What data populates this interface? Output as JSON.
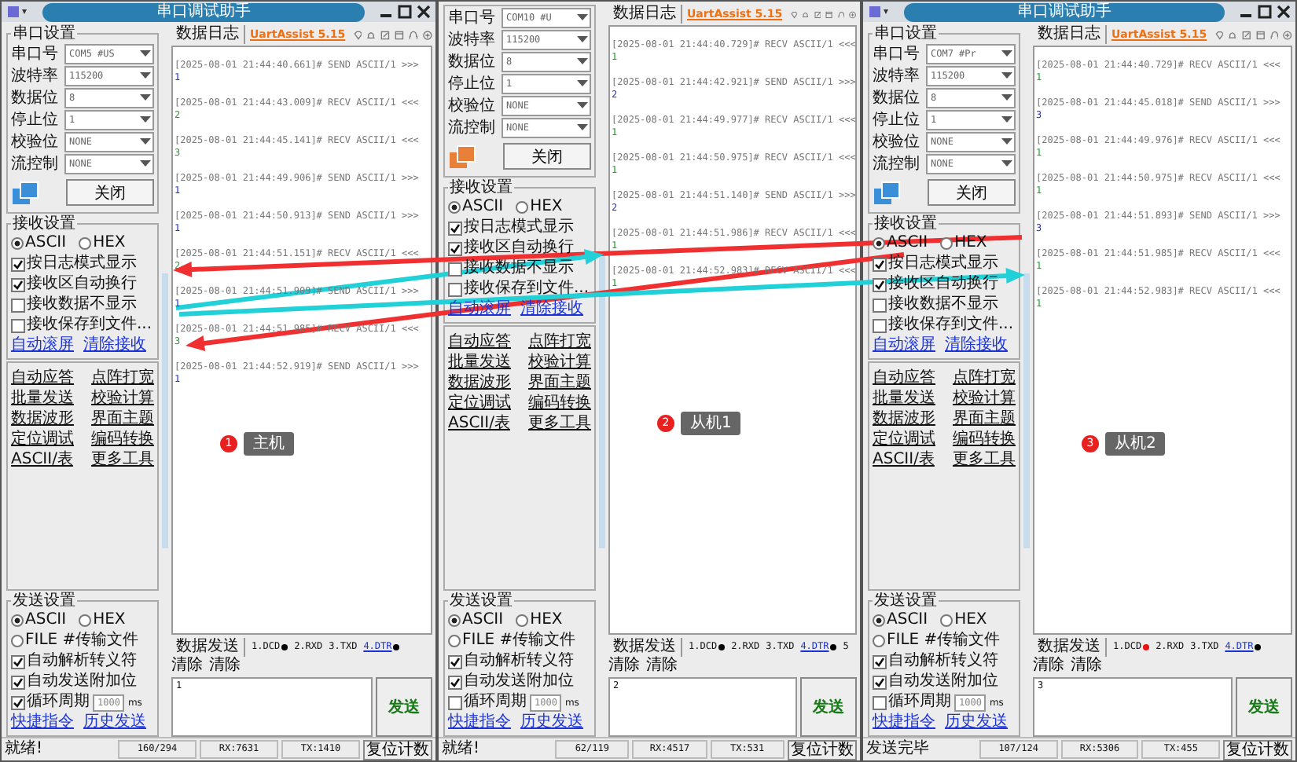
{
  "windows": [
    {
      "title": "串口调试助手",
      "port_settings": {
        "title": "串口设置",
        "fields": [
          {
            "label": "串口号",
            "value": "COM5 #US"
          },
          {
            "label": "波特率",
            "value": "115200"
          },
          {
            "label": "数据位",
            "value": "8"
          },
          {
            "label": "停止位",
            "value": "1"
          },
          {
            "label": "校验位",
            "value": "NONE"
          },
          {
            "label": "流控制",
            "value": "NONE"
          }
        ],
        "color": "#3a8fd8",
        "close_button": "关闭"
      },
      "receive_settings": {
        "title": "接收设置",
        "modes": [
          {
            "label": "ASCII",
            "selected": true
          },
          {
            "label": "HEX",
            "selected": false
          }
        ],
        "options": [
          {
            "label": "按日志模式显示",
            "checked": true
          },
          {
            "label": "接收区自动换行",
            "checked": true
          },
          {
            "label": "接收数据不显示",
            "checked": false
          },
          {
            "label": "接收保存到文件...",
            "checked": false
          }
        ],
        "links": [
          "自动滚屏",
          "清除接收"
        ]
      },
      "tools": [
        "自动应答",
        "点阵打宽",
        "批量发送",
        "校验计算",
        "数据波形",
        "界面主题",
        "定位调试",
        "编码转换",
        "ASCII/表",
        "更多工具"
      ],
      "send_settings": {
        "title": "发送设置",
        "modes": [
          {
            "label": "ASCII",
            "selected": true
          },
          {
            "label": "HEX",
            "selected": false
          }
        ],
        "file_mode": {
          "label": "FILE #传输文件",
          "selected": false
        },
        "options": [
          {
            "label": "自动解析转义符",
            "checked": true
          },
          {
            "label": "自动发送附加位",
            "checked": true
          }
        ],
        "cycle": {
          "label": "循环周期",
          "checked": true,
          "value": "1000",
          "unit": "ms"
        },
        "links": [
          "快捷指令",
          "历史发送"
        ]
      },
      "log_tab": "数据日志",
      "brand": "UartAssist 5.15",
      "log": [
        {
          "header": "[2025-08-01 21:44:40.661]# SEND ASCII/1 >>>",
          "kind": "send",
          "data": "1"
        },
        {
          "header": "[2025-08-01 21:44:43.009]# RECV ASCII/1 <<<",
          "kind": "recv",
          "data": "2"
        },
        {
          "header": "[2025-08-01 21:44:45.141]# RECV ASCII/1 <<<",
          "kind": "recv",
          "data": "3"
        },
        {
          "header": "[2025-08-01 21:44:49.906]# SEND ASCII/1 >>>",
          "kind": "send",
          "data": "1"
        },
        {
          "header": "[2025-08-01 21:44:50.913]# SEND ASCII/1 >>>",
          "kind": "send",
          "data": "1"
        },
        {
          "header": "[2025-08-01 21:44:51.151]# RECV ASCII/1 <<<",
          "kind": "recv",
          "data": "2"
        },
        {
          "header": "[2025-08-01 21:44:51.909]# SEND ASCII/1 >>>",
          "kind": "send",
          "data": "1"
        },
        {
          "header": "[2025-08-01 21:44:51.985]# RECV ASCII/1 <<<",
          "kind": "recv",
          "data": "3"
        },
        {
          "header": "[2025-08-01 21:44:52.919]# SEND ASCII/1 >>>",
          "kind": "send",
          "data": "1"
        }
      ],
      "send_tab": "数据发送",
      "signals": [
        {
          "label": "1.DCD",
          "kind": "plain",
          "color": "#000000"
        },
        {
          "label": "2.RXD",
          "kind": "plain"
        },
        {
          "label": "3.TXD",
          "kind": "plain"
        },
        {
          "label": "4.DTR",
          "kind": "link",
          "color": "#000000"
        }
      ],
      "clear_buttons": [
        "清除",
        "清除"
      ],
      "send_input": "1",
      "send_button": "发送",
      "status": {
        "message": "就绪!",
        "counts": [
          "160/294",
          "RX:7631",
          "TX:1410"
        ],
        "reset_button": "复位计数"
      },
      "annotation": {
        "number": "1",
        "label": "主机"
      }
    },
    {
      "port_settings": {
        "fields": [
          {
            "label": "串口号",
            "value": "COM10 #U"
          },
          {
            "label": "波特率",
            "value": "115200"
          },
          {
            "label": "数据位",
            "value": "8"
          },
          {
            "label": "停止位",
            "value": "1"
          },
          {
            "label": "校验位",
            "value": "NONE"
          },
          {
            "label": "流控制",
            "value": "NONE"
          }
        ],
        "color": "#e8803a",
        "close_button": "关闭"
      },
      "receive_settings": {
        "title": "接收设置",
        "modes": [
          {
            "label": "ASCII",
            "selected": true
          },
          {
            "label": "HEX",
            "selected": false
          }
        ],
        "options": [
          {
            "label": "按日志模式显示",
            "checked": true
          },
          {
            "label": "接收区自动换行",
            "checked": true
          },
          {
            "label": "接收数据不显示",
            "checked": false
          },
          {
            "label": "接收保存到文件...",
            "checked": false
          }
        ],
        "links": [
          "自动滚屏",
          "清除接收"
        ]
      },
      "tools": [
        "自动应答",
        "点阵打宽",
        "批量发送",
        "校验计算",
        "数据波形",
        "界面主题",
        "定位调试",
        "编码转换",
        "ASCII/表",
        "更多工具"
      ],
      "send_settings": {
        "title": "发送设置",
        "modes": [
          {
            "label": "ASCII",
            "selected": true
          },
          {
            "label": "HEX",
            "selected": false
          }
        ],
        "file_mode": {
          "label": "FILE #传输文件",
          "selected": false
        },
        "options": [
          {
            "label": "自动解析转义符",
            "checked": true
          },
          {
            "label": "自动发送附加位",
            "checked": true
          }
        ],
        "cycle": {
          "label": "循环周期",
          "checked": false,
          "value": "1000",
          "unit": "ms"
        },
        "links": [
          "快捷指令",
          "历史发送"
        ]
      },
      "log_tab": "数据日志",
      "brand": "UartAssist 5.15",
      "log": [
        {
          "header": "[2025-08-01 21:44:40.729]# RECV ASCII/1 <<<",
          "kind": "recv",
          "data": "1"
        },
        {
          "header": "[2025-08-01 21:44:42.921]# SEND ASCII/1 >>>",
          "kind": "send",
          "data": "2"
        },
        {
          "header": "[2025-08-01 21:44:49.977]# RECV ASCII/1 <<<",
          "kind": "recv",
          "data": "1"
        },
        {
          "header": "[2025-08-01 21:44:50.975]# RECV ASCII/1 <<<",
          "kind": "recv",
          "data": "1"
        },
        {
          "header": "[2025-08-01 21:44:51.140]# SEND ASCII/1 >>>",
          "kind": "send",
          "data": "2"
        },
        {
          "header": "[2025-08-01 21:44:51.986]# RECV ASCII/1 <<<",
          "kind": "recv",
          "data": "1"
        },
        {
          "header": "[2025-08-01 21:44:52.983]# RECV ASCII/1 <<<",
          "kind": "recv",
          "data": "1"
        }
      ],
      "send_tab": "数据发送",
      "signals": [
        {
          "label": "1.DCD",
          "kind": "plain",
          "color": "#000000"
        },
        {
          "label": "2.RXD",
          "kind": "plain"
        },
        {
          "label": "3.TXD",
          "kind": "plain"
        },
        {
          "label": "4.DTR",
          "kind": "link",
          "color": "#000000"
        },
        {
          "label": "5",
          "kind": "plain"
        }
      ],
      "clear_buttons": [
        "清除",
        "清除"
      ],
      "send_input": "2",
      "send_button": "发送",
      "status": {
        "message": "就绪!",
        "counts": [
          "62/119",
          "RX:4517",
          "TX:531"
        ],
        "reset_button": "复位计数"
      },
      "annotation": {
        "number": "2",
        "label": "从机1"
      }
    },
    {
      "title": "串口调试助手",
      "port_settings": {
        "title": "串口设置",
        "fields": [
          {
            "label": "串口号",
            "value": "COM7 #Pr"
          },
          {
            "label": "波特率",
            "value": "115200"
          },
          {
            "label": "数据位",
            "value": "8"
          },
          {
            "label": "停止位",
            "value": "1"
          },
          {
            "label": "校验位",
            "value": "NONE"
          },
          {
            "label": "流控制",
            "value": "NONE"
          }
        ],
        "color": "#3a8fd8",
        "close_button": "关闭"
      },
      "receive_settings": {
        "title": "接收设置",
        "modes": [
          {
            "label": "ASCII",
            "selected": true
          },
          {
            "label": "HEX",
            "selected": false
          }
        ],
        "options": [
          {
            "label": "按日志模式显示",
            "checked": true
          },
          {
            "label": "接收区自动换行",
            "checked": true
          },
          {
            "label": "接收数据不显示",
            "checked": false
          },
          {
            "label": "接收保存到文件...",
            "checked": false
          }
        ],
        "links": [
          "自动滚屏",
          "清除接收"
        ]
      },
      "tools": [
        "自动应答",
        "点阵打宽",
        "批量发送",
        "校验计算",
        "数据波形",
        "界面主题",
        "定位调试",
        "编码转换",
        "ASCII/表",
        "更多工具"
      ],
      "send_settings": {
        "title": "发送设置",
        "modes": [
          {
            "label": "ASCII",
            "selected": true
          },
          {
            "label": "HEX",
            "selected": false
          }
        ],
        "file_mode": {
          "label": "FILE #传输文件",
          "selected": false
        },
        "options": [
          {
            "label": "自动解析转义符",
            "checked": true
          },
          {
            "label": "自动发送附加位",
            "checked": true
          }
        ],
        "cycle": {
          "label": "循环周期",
          "checked": false,
          "value": "1000",
          "unit": "ms"
        },
        "links": [
          "快捷指令",
          "历史发送"
        ]
      },
      "log_tab": "数据日志",
      "brand": "UartAssist 5.15",
      "log": [
        {
          "header": "[2025-08-01 21:44:40.729]# RECV ASCII/1 <<<",
          "kind": "recv",
          "data": "1"
        },
        {
          "header": "[2025-08-01 21:44:45.018]# SEND ASCII/1 >>>",
          "kind": "send",
          "data": "3"
        },
        {
          "header": "[2025-08-01 21:44:49.976]# RECV ASCII/1 <<<",
          "kind": "recv",
          "data": "1"
        },
        {
          "header": "[2025-08-01 21:44:50.975]# RECV ASCII/1 <<<",
          "kind": "recv",
          "data": "1"
        },
        {
          "header": "[2025-08-01 21:44:51.893]# SEND ASCII/1 >>>",
          "kind": "send",
          "data": "3"
        },
        {
          "header": "[2025-08-01 21:44:51.985]# RECV ASCII/1 <<<",
          "kind": "recv",
          "data": "1"
        },
        {
          "header": "[2025-08-01 21:44:52.983]# RECV ASCII/1 <<<",
          "kind": "recv",
          "data": "1"
        }
      ],
      "send_tab": "数据发送",
      "signals": [
        {
          "label": "1.DCD",
          "kind": "plain",
          "color": "#ee1111"
        },
        {
          "label": "2.RXD",
          "kind": "plain"
        },
        {
          "label": "3.TXD",
          "kind": "plain"
        },
        {
          "label": "4.DTR",
          "kind": "link",
          "color": "#000000"
        }
      ],
      "clear_buttons": [
        "清除",
        "清除"
      ],
      "send_input": "3",
      "send_button": "发送",
      "status": {
        "message": "发送完毕",
        "counts": [
          "107/124",
          "RX:5306",
          "TX:455"
        ],
        "reset_button": "复位计数"
      },
      "annotation": {
        "number": "3",
        "label": "从机2"
      }
    }
  ]
}
